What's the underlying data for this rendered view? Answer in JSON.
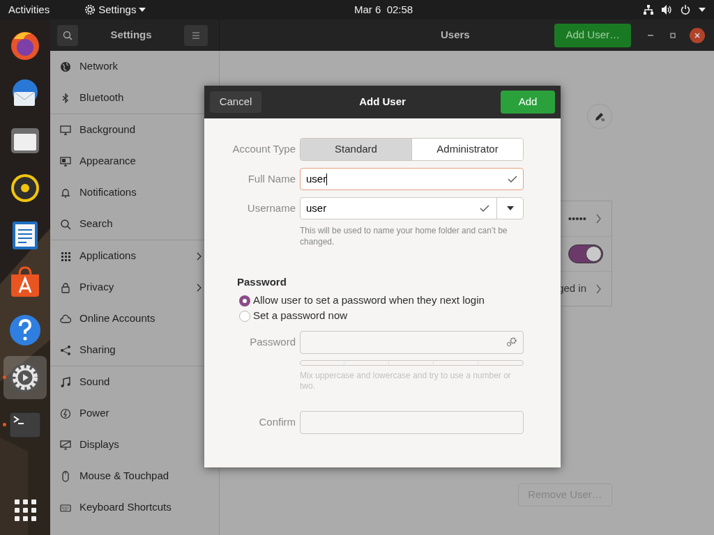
{
  "top_bar": {
    "activities": "Activities",
    "app_menu": "Settings",
    "clock": "Mar 6  02:58"
  },
  "dock": [
    {
      "running": false,
      "active": false
    },
    {
      "running": false,
      "active": false
    },
    {
      "running": false,
      "active": false
    },
    {
      "running": false,
      "active": false
    },
    {
      "running": false,
      "active": false
    },
    {
      "running": false,
      "active": false
    },
    {
      "running": false,
      "active": false
    },
    {
      "running": true,
      "active": true
    },
    {
      "running": true,
      "active": false
    }
  ],
  "sidebar": {
    "title": "Settings",
    "groups": [
      [
        {
          "label": "Network",
          "expandable": false
        },
        {
          "label": "Bluetooth",
          "expandable": false
        }
      ],
      [
        {
          "label": "Background",
          "expandable": false
        },
        {
          "label": "Appearance",
          "expandable": false
        },
        {
          "label": "Notifications",
          "expandable": false
        },
        {
          "label": "Search",
          "expandable": false
        }
      ],
      [
        {
          "label": "Applications",
          "expandable": true
        },
        {
          "label": "Privacy",
          "expandable": true
        },
        {
          "label": "Online Accounts",
          "expandable": false
        },
        {
          "label": "Sharing",
          "expandable": false
        }
      ],
      [
        {
          "label": "Sound",
          "expandable": false
        },
        {
          "label": "Power",
          "expandable": false
        },
        {
          "label": "Displays",
          "expandable": false
        },
        {
          "label": "Mouse & Touchpad",
          "expandable": false
        },
        {
          "label": "Keyboard Shortcuts",
          "expandable": false
        }
      ]
    ]
  },
  "header": {
    "title": "Users",
    "add_button": "Add User…"
  },
  "users_panel": {
    "rows": [
      {
        "kind": "value",
        "text": "•••••"
      },
      {
        "kind": "switch",
        "on": true
      },
      {
        "kind": "value",
        "text": "ged in"
      }
    ]
  },
  "remove_button": "Remove User…",
  "dialog": {
    "title": "Add User",
    "cancel": "Cancel",
    "add": "Add",
    "account_type": {
      "label": "Account Type",
      "options": [
        {
          "label": "Standard",
          "selected": true
        },
        {
          "label": "Administrator",
          "selected": false
        }
      ]
    },
    "full_name": {
      "label": "Full Name",
      "value": "user",
      "valid": true,
      "focused": true
    },
    "username": {
      "label": "Username",
      "value": "user",
      "valid": true,
      "hint": "This will be used to name your home folder and can’t be changed."
    },
    "password_section": {
      "title": "Password",
      "options": [
        {
          "label": "Allow user to set a password when they next login",
          "selected": true
        },
        {
          "label": "Set a password now",
          "selected": false
        }
      ]
    },
    "password": {
      "label": "Password",
      "hint": "Mix uppercase and lowercase and try to use a number or two."
    },
    "confirm": {
      "label": "Confirm"
    }
  }
}
